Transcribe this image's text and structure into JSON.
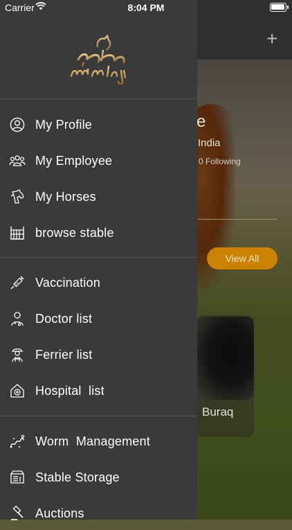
{
  "status_bar": {
    "carrier": "Carrier",
    "time": "8:04 PM"
  },
  "drawer": {
    "logo_alt": "مرحل mirhaly logo",
    "menu": [
      {
        "label": "My Profile",
        "icon": "user-circle-icon"
      },
      {
        "label": "My Employee",
        "icon": "employees-icon"
      },
      {
        "label": "My Horses",
        "icon": "horse-head-icon"
      },
      {
        "label": "browse stable",
        "icon": "stable-fence-icon"
      },
      {
        "label": "Vaccination",
        "icon": "syringe-icon"
      },
      {
        "label": "Doctor list",
        "icon": "doctor-icon"
      },
      {
        "label": "Ferrier list",
        "icon": "farrier-icon"
      },
      {
        "label": "Hospital  list",
        "icon": "hospital-icon"
      },
      {
        "label": "Worm  Management",
        "icon": "worm-icon"
      },
      {
        "label": "Stable Storage",
        "icon": "storage-icon"
      },
      {
        "label": "Auctions",
        "icon": "gavel-icon"
      }
    ]
  },
  "background": {
    "title_fragment": "e",
    "location_fragment": "India",
    "following": "0 Following",
    "view_all": "View All",
    "card_name": "Buraq"
  },
  "colors": {
    "drawer_bg": "#3a3a3a",
    "accent": "#c98300",
    "text": "#ffffff"
  }
}
